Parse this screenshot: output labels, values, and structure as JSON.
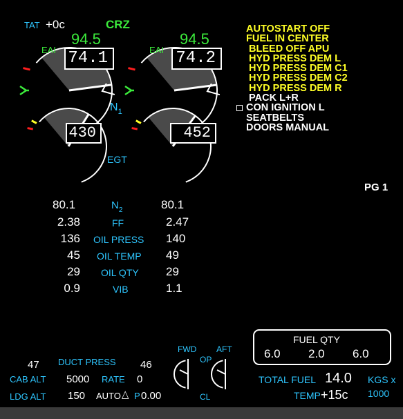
{
  "colors": {
    "background": "#000000",
    "white": "#ffffff",
    "cyan": "#2ec6ff",
    "green": "#3bea3b",
    "yellow": "#ffff26",
    "red": "#ff1e1e",
    "dial_fill": "#4a4a4a"
  },
  "header": {
    "tat_label": "TAT",
    "tat_value": "+0c",
    "thrust_mode": "CRZ"
  },
  "eicas": {
    "eai_label": "EAI",
    "n1_label": "N",
    "n1_subscript": "1",
    "egt_label": "EGT",
    "engines": [
      {
        "name": "engine-1",
        "n1_target": "94.5",
        "n1": "74.1",
        "n1_value": 74.1,
        "egt": "430",
        "egt_value": 430
      },
      {
        "name": "engine-2",
        "n1_target": "94.5",
        "n1": "74.2",
        "n1_value": 74.2,
        "egt": "452",
        "egt_value": 452
      }
    ]
  },
  "alerts": {
    "messages": [
      {
        "text": "AUTOSTART OFF",
        "color": "yellow"
      },
      {
        "text": "FUEL IN CENTER",
        "color": "yellow"
      },
      {
        "text": " BLEED OFF APU",
        "color": "yellow"
      },
      {
        "text": " HYD PRESS DEM L",
        "color": "yellow"
      },
      {
        "text": " HYD PRESS DEM C1",
        "color": "yellow"
      },
      {
        "text": " HYD PRESS DEM C2",
        "color": "yellow"
      },
      {
        "text": " HYD PRESS DEM R",
        "color": "yellow"
      },
      {
        "text": " PACK L+R",
        "color": "white"
      },
      {
        "text": "CON IGNITION L",
        "color": "white"
      },
      {
        "text": "SEATBELTS",
        "color": "white"
      },
      {
        "text": "DOORS MANUAL",
        "color": "white"
      }
    ],
    "page": "PG 1"
  },
  "secondary": {
    "n2_label": "N",
    "n2_subscript": "2",
    "rows": [
      {
        "label": "FF",
        "left": "2.38",
        "right": "2.47"
      },
      {
        "label": "OIL PRESS",
        "left": "136",
        "right": "140"
      },
      {
        "label": "OIL TEMP",
        "left": "45",
        "right": "49"
      },
      {
        "label": "OIL QTY",
        "left": "29",
        "right": "29"
      },
      {
        "label": "VIB",
        "left": "0.9",
        "right": "1.1"
      }
    ],
    "n2_left": "80.1",
    "n2_right": "80.1"
  },
  "cabin": {
    "duct_press_label": "DUCT PRESS",
    "duct_left": "47",
    "duct_right": "46",
    "cab_alt_label": "CAB ALT",
    "cab_alt": "5000",
    "rate_label": "RATE",
    "rate": "0",
    "ldg_alt_label": "LDG ALT",
    "ldg_alt": "150",
    "ldg_mode": "AUTO",
    "delta_p_label": "P",
    "delta_p": "0.00"
  },
  "valves": {
    "fwd_label": "FWD",
    "aft_label": "AFT",
    "op_label": "OP",
    "cl_label": "CL"
  },
  "fuel": {
    "qty_label": "FUEL QTY",
    "left_tank": "6.0",
    "center_tank": "2.0",
    "right_tank": "6.0",
    "total_label": "TOTAL FUEL",
    "total": "14.0",
    "units_label": "KGS x",
    "units_mult": "1000",
    "temp_label": "TEMP",
    "temp": "+15c"
  }
}
